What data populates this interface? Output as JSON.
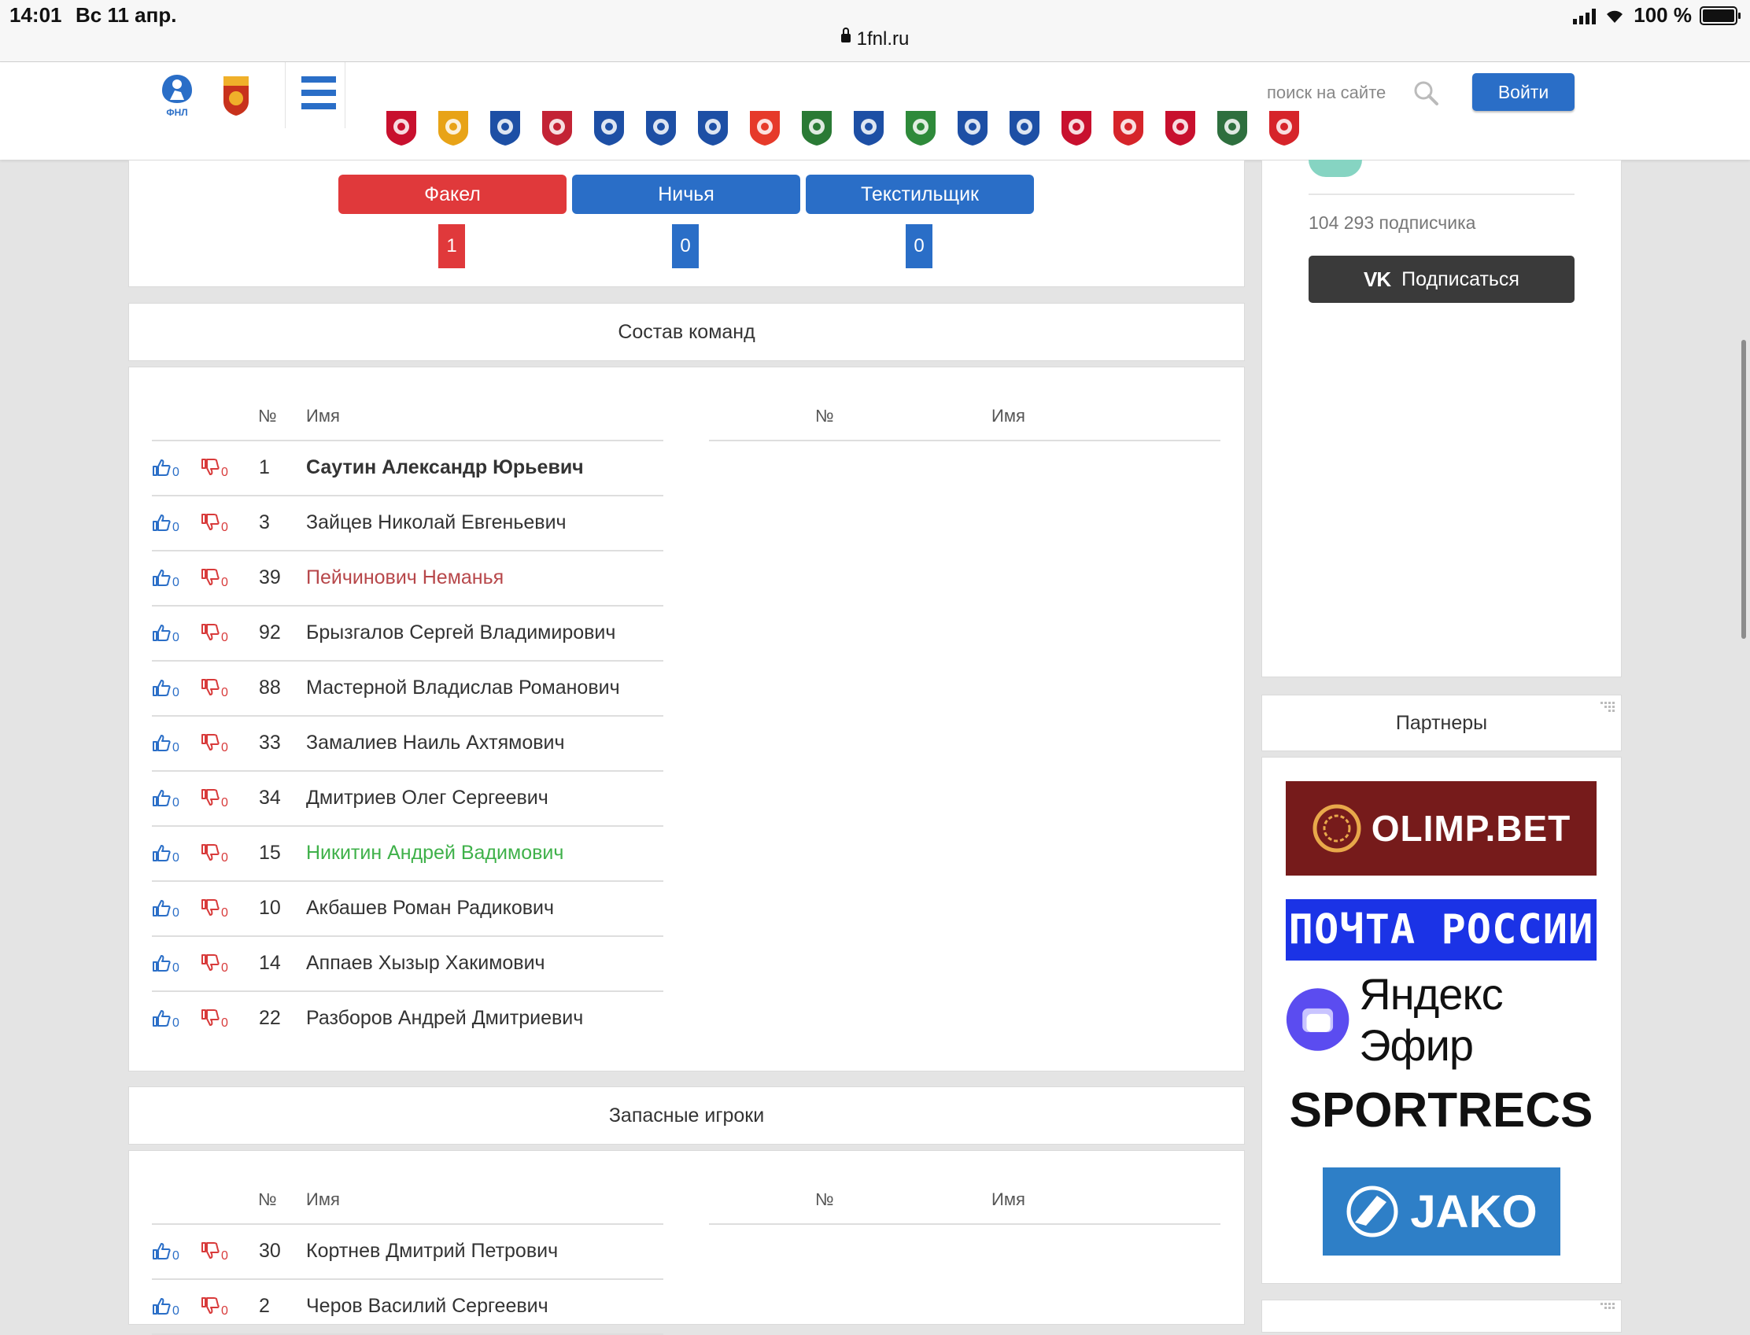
{
  "status_bar": {
    "time": "14:01",
    "date": "Вс 11 апр.",
    "battery": "100 %"
  },
  "browser": {
    "url": "1fnl.ru"
  },
  "header": {
    "search_placeholder": "поиск на сайте",
    "login_label": "Войти",
    "club_colors": [
      "#c8102e",
      "#e8a317",
      "#1d4fa5",
      "#c32335",
      "#1d4fa5",
      "#1d4fa5",
      "#1d4fa5",
      "#e63a2a",
      "#2a7a35",
      "#1d4fa5",
      "#2e8a3a",
      "#1d4fa5",
      "#1d4fa5",
      "#c8102e",
      "#d6242a",
      "#c8102e",
      "#2e6f3e",
      "#d6242a"
    ]
  },
  "vote": {
    "options": [
      {
        "label": "Факел",
        "count": "1",
        "color": "#e0393b"
      },
      {
        "label": "Ничья",
        "count": "0",
        "color": "#2a6ec7"
      },
      {
        "label": "Текстильщик",
        "count": "0",
        "color": "#2a6ec7"
      }
    ]
  },
  "lineups": {
    "title": "Состав команд",
    "col_num": "№",
    "col_name": "Имя",
    "rows": [
      {
        "num": "1",
        "name": "Саутин Александр Юрьевич",
        "style": "bold",
        "likes": "0",
        "dislikes": "0"
      },
      {
        "num": "3",
        "name": "Зайцев Николай Евгеньевич",
        "style": "",
        "likes": "0",
        "dislikes": "0"
      },
      {
        "num": "39",
        "name": "Пейчинович Неманья",
        "style": "red",
        "likes": "0",
        "dislikes": "0"
      },
      {
        "num": "92",
        "name": "Брызгалов Сергей Владимирович",
        "style": "",
        "likes": "0",
        "dislikes": "0"
      },
      {
        "num": "88",
        "name": "Мастерной Владислав Романович",
        "style": "",
        "likes": "0",
        "dislikes": "0"
      },
      {
        "num": "33",
        "name": "Замалиев Наиль Ахтямович",
        "style": "",
        "likes": "0",
        "dislikes": "0"
      },
      {
        "num": "34",
        "name": "Дмитриев Олег Сергеевич",
        "style": "",
        "likes": "0",
        "dislikes": "0"
      },
      {
        "num": "15",
        "name": "Никитин Андрей Вадимович",
        "style": "green",
        "likes": "0",
        "dislikes": "0"
      },
      {
        "num": "10",
        "name": "Акбашев Роман Радикович",
        "style": "",
        "likes": "0",
        "dislikes": "0"
      },
      {
        "num": "14",
        "name": "Аппаев Хызыр Хакимович",
        "style": "",
        "likes": "0",
        "dislikes": "0"
      },
      {
        "num": "22",
        "name": "Разборов Андрей Дмитриевич",
        "style": "",
        "likes": "0",
        "dislikes": "0"
      }
    ]
  },
  "substitutes": {
    "title": "Запасные игроки",
    "col_num": "№",
    "col_name": "Имя",
    "rows": [
      {
        "num": "30",
        "name": "Кортнев Дмитрий Петрович",
        "style": "",
        "likes": "0",
        "dislikes": "0"
      },
      {
        "num": "2",
        "name": "Черов Василий Сергеевич",
        "style": "",
        "likes": "0",
        "dislikes": "0"
      }
    ]
  },
  "sidebar": {
    "vk_subscribers": "104 293 подписчика",
    "vk_button": "Подписаться",
    "partners_title": "Партнеры",
    "partners": [
      {
        "name": "OLIMP.BET"
      },
      {
        "name": "ПОЧТА РОССИИ"
      },
      {
        "name": "Яндекс Эфир"
      },
      {
        "name": "SPORTRECS"
      },
      {
        "name": "JAKO"
      }
    ]
  }
}
